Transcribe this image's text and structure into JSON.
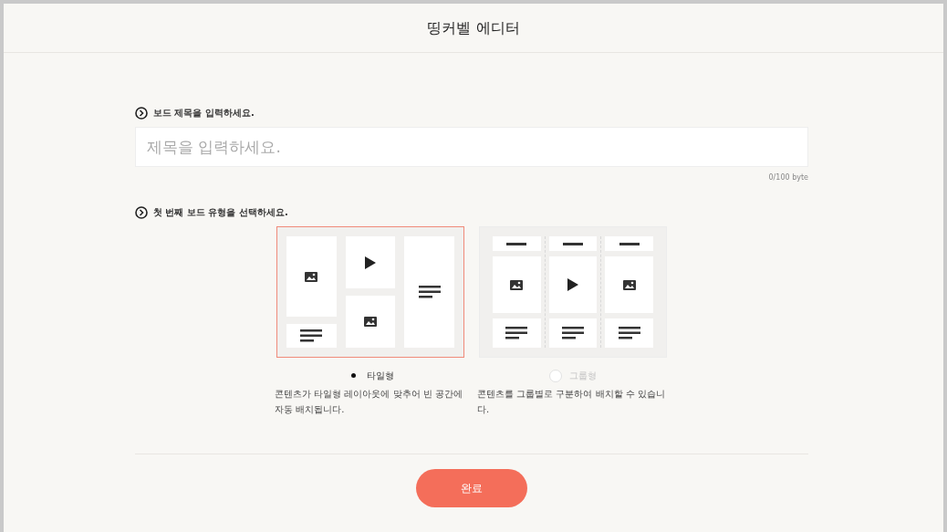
{
  "header": {
    "title": "띵커벨 에디터"
  },
  "title_section": {
    "label": "보드 제목을 입력하세요.",
    "placeholder": "제목을 입력하세요.",
    "byte_count": "0/100 byte"
  },
  "type_section": {
    "label": "첫 번째 보드 유형을 선택하세요.",
    "types": [
      {
        "kind": "tile",
        "label": "타일형",
        "selected": true,
        "description": "콘텐츠가 타일형 레이아웃에 맞추어 빈 공간에 자동 배치됩니다."
      },
      {
        "kind": "group",
        "label": "그룹형",
        "selected": false,
        "description": "콘텐츠를 그룹별로 구분하여 배치할 수 있습니다."
      }
    ]
  },
  "submit": {
    "label": "완료"
  }
}
